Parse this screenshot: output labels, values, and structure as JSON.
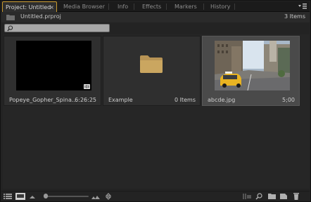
{
  "tabs": [
    {
      "label": "Project: Untitled",
      "active": true
    },
    {
      "label": "Media Browser"
    },
    {
      "label": "Info"
    },
    {
      "label": "Effects"
    },
    {
      "label": "Markers"
    },
    {
      "label": "History"
    }
  ],
  "tab_close": "×",
  "project": {
    "file_name": "Untitled.prproj",
    "item_count": "3 Items"
  },
  "search": {
    "placeholder": ""
  },
  "items": [
    {
      "name": "Popeye_Gopher_Spina...",
      "meta": "6:26:25",
      "kind": "sequence"
    },
    {
      "name": "Example",
      "meta": "0 Items",
      "kind": "bin"
    },
    {
      "name": "abcde.jpg",
      "meta": "5;00",
      "kind": "still",
      "selected": true
    }
  ],
  "zoom": {
    "level": 0.05
  },
  "colors": {
    "accent": "#c99a2e",
    "folder": "#c9a35d",
    "selection": "#4a4a4a"
  },
  "icons": {
    "panel_menu": "panel-menu-icon",
    "list_view": "list-view-icon",
    "icon_view": "icon-view-icon",
    "automate": "automate-to-sequence-icon",
    "find": "find-icon",
    "new_bin": "new-bin-icon",
    "new_item": "new-item-icon",
    "clear": "trash-icon"
  }
}
